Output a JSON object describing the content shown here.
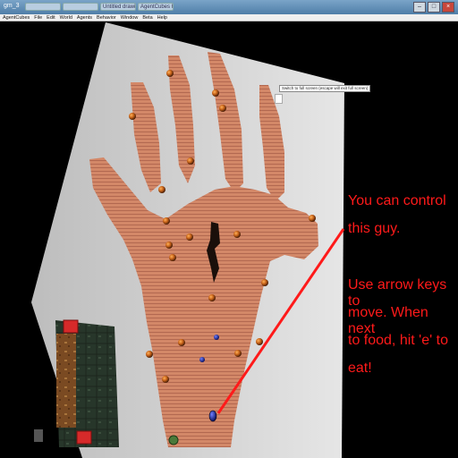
{
  "window": {
    "title": "gm_3",
    "tabs": [
      "",
      "",
      "Untitled drawing - Google",
      "AgentCubes Hand - CS"
    ],
    "buttons": [
      "–",
      "□",
      "×"
    ]
  },
  "menubar": {
    "items": [
      "AgentCubes",
      "File",
      "Edit",
      "World",
      "Agents",
      "Behavior",
      "Window",
      "Beta",
      "Help"
    ]
  },
  "tooltip": {
    "text": "Switch to full screen (escape will exit full screen)"
  },
  "annotation": {
    "line1": "You can control",
    "line2": "this guy.",
    "line3": "Use arrow keys to",
    "line4": "move. When next",
    "line5": "to food, hit 'e' to",
    "line6": "eat!"
  },
  "colors": {
    "annotation": "#ff1a1a",
    "hand": "#d58a6a",
    "floor": "#d9d9d9",
    "food": "#c8641a",
    "player": "#1a2fa8",
    "grass": "#2a3a2a"
  }
}
